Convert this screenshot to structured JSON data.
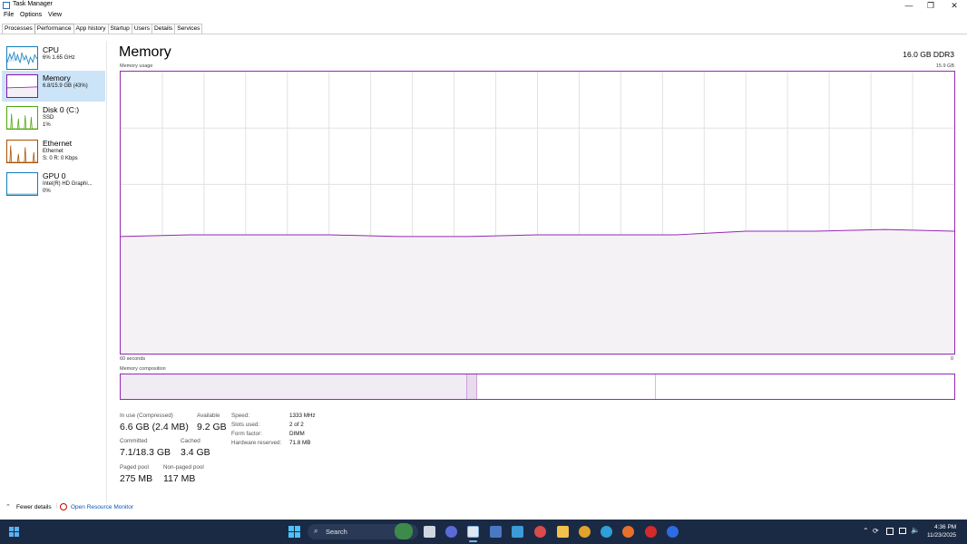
{
  "window": {
    "title": "Task Manager",
    "buttons": {
      "minimize": "—",
      "restore": "❐",
      "close": "✕"
    }
  },
  "menu": [
    "File",
    "Options",
    "View"
  ],
  "tabs": [
    "Processes",
    "Performance",
    "App history",
    "Startup",
    "Users",
    "Details",
    "Services"
  ],
  "active_tab": "Performance",
  "sidebar": {
    "items": [
      {
        "name": "CPU",
        "sub1": "6%  1.65 GHz",
        "color": "#117dbb"
      },
      {
        "name": "Memory",
        "sub1": "6.8/15.9 GB (43%)",
        "color": "#8b12ae",
        "selected": true
      },
      {
        "name": "Disk 0 (C:)",
        "sub1": "SSD",
        "sub2": "1%",
        "color": "#4da60c"
      },
      {
        "name": "Ethernet",
        "sub1": "Ethernet",
        "sub2": "S: 0  R: 0 Kbps",
        "color": "#a74f01"
      },
      {
        "name": "GPU 0",
        "sub1": "Intel(R) HD Graphi...",
        "sub2": "0%",
        "color": "#117dbb"
      }
    ]
  },
  "main": {
    "title": "Memory",
    "spec": "16.0 GB DDR3",
    "usage_label": "Memory usage",
    "usage_max": "15.9 GB",
    "time_left": "60 seconds",
    "time_right": "0",
    "composition_label": "Memory composition"
  },
  "stats": {
    "in_use_label": "In use (Compressed)",
    "in_use_value": "6.6 GB (2.4 MB)",
    "available_label": "Available",
    "available_value": "9.2 GB",
    "committed_label": "Committed",
    "committed_value": "7.1/18.3 GB",
    "cached_label": "Cached",
    "cached_value": "3.4 GB",
    "paged_label": "Paged pool",
    "paged_value": "275 MB",
    "nonpaged_label": "Non-paged pool",
    "nonpaged_value": "117 MB"
  },
  "specs": [
    {
      "label": "Speed:",
      "value": "1333 MHz"
    },
    {
      "label": "Slots used:",
      "value": "2 of 2"
    },
    {
      "label": "Form factor:",
      "value": "DIMM"
    },
    {
      "label": "Hardware reserved:",
      "value": "71.8 MB"
    }
  ],
  "footer": {
    "fewer_details": "Fewer details",
    "resource_monitor": "Open Resource Monitor"
  },
  "taskbar": {
    "search": "Search",
    "time": "4:36 PM",
    "date": "11/23/2025"
  },
  "chart_data": {
    "type": "area",
    "x": [
      60,
      55,
      50,
      45,
      40,
      35,
      30,
      25,
      20,
      15,
      10,
      5,
      0
    ],
    "values": [
      6.6,
      6.7,
      6.7,
      6.7,
      6.6,
      6.6,
      6.7,
      6.7,
      6.7,
      6.9,
      6.9,
      7.0,
      6.9
    ],
    "ylim": [
      0,
      15.9
    ],
    "xlim": [
      60,
      0
    ],
    "grid": true,
    "composition": {
      "in_use": 6.6,
      "modified": 0.2,
      "standby": 3.4,
      "free": 5.7
    }
  },
  "colors": {
    "memory": "#9528b4",
    "fill": "#f4f2f5",
    "grid": "#e2e2e2",
    "taskbar": "#1a2a44"
  }
}
